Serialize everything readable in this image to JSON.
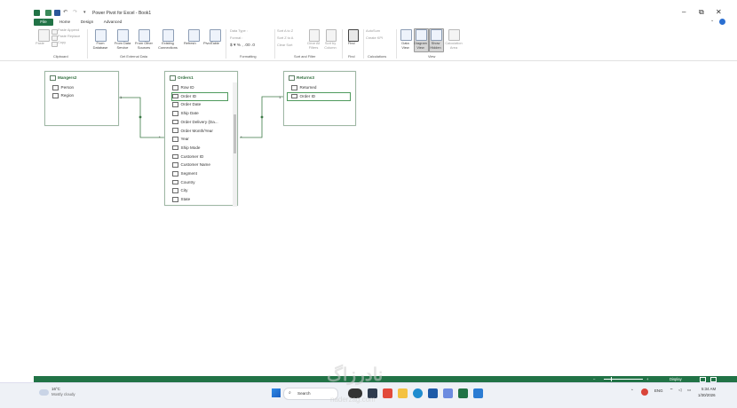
{
  "app": {
    "title": "Power Pivot for Excel - Book1",
    "window_controls": [
      "–",
      "⧉",
      "✕"
    ]
  },
  "tabs": [
    {
      "label": "File",
      "active": true
    },
    {
      "label": "Home",
      "active": false
    },
    {
      "label": "Design",
      "active": false
    },
    {
      "label": "Advanced",
      "active": false
    }
  ],
  "ribbon": {
    "clipboard": {
      "paste": "Paste",
      "paste_append": "Paste Append",
      "paste_replace": "Paste Replace",
      "copy": "Copy",
      "group": "Clipboard"
    },
    "external": {
      "from_database": "From Database",
      "from_data_service": "From Data Service",
      "from_other_sources": "From Other Sources",
      "existing_connections": "Existing Connections",
      "group": "Get External Data"
    },
    "refresh": "Refresh",
    "pivottable": "PivotTable",
    "formatting": {
      "data_type": "Data Type :",
      "format": "Format :",
      "symbols": "$ ▾  %  ,  .00  .0",
      "group": "Formatting"
    },
    "sort": {
      "sort_a_z": "Sort A to Z",
      "sort_z_a": "Sort Z to A",
      "clear_sort": "Clear Sort",
      "clear_all_filters": "Clear All Filters",
      "sort_by_column": "Sort by Column",
      "group": "Sort and Filter"
    },
    "find": {
      "label": "Find",
      "group": "Find"
    },
    "calculations": {
      "autosum": "AutoSum",
      "create_kpi": "Create KPI",
      "group": "Calculations"
    },
    "view": {
      "data_view": "Data View",
      "diagram_view": "Diagram View",
      "show_hidden": "Show Hidden",
      "calculation_area": "Calculation Area",
      "group": "View"
    }
  },
  "tables": {
    "managers": {
      "name": "Mangers2",
      "fields": [
        "Person",
        "Region"
      ]
    },
    "orders": {
      "name": "Orders1",
      "fields": [
        "Row ID",
        "Order ID",
        "Order Date",
        "Ship Date",
        "Order Delivery (Da...",
        "Order Month/Year",
        "Year",
        "Ship Mode",
        "Customer ID",
        "Customer Name",
        "Segment",
        "Country",
        "City",
        "State"
      ],
      "selected_field": "Order ID"
    },
    "returns": {
      "name": "Returns3",
      "fields": [
        "Returned",
        "Order ID"
      ],
      "selected_field": "Order ID"
    }
  },
  "relationships": {
    "one_marker": "1",
    "many_marker": "*"
  },
  "statusbar": {
    "zoom_minus": "–",
    "zoom_plus": "+",
    "display": "Display"
  },
  "taskbar": {
    "weather_temp": "16°C",
    "weather_desc": "Mostly cloudy",
    "search_placeholder": "Search",
    "lang": "ENG",
    "time": "5:34 AM",
    "date": "1/30/2026"
  },
  "watermark": {
    "text": "نادرزاگ",
    "url": "naderzag.com"
  },
  "colors": {
    "accent": "#217346",
    "diagram_bg": "#ffffff",
    "relation": "#2f7d3c"
  }
}
